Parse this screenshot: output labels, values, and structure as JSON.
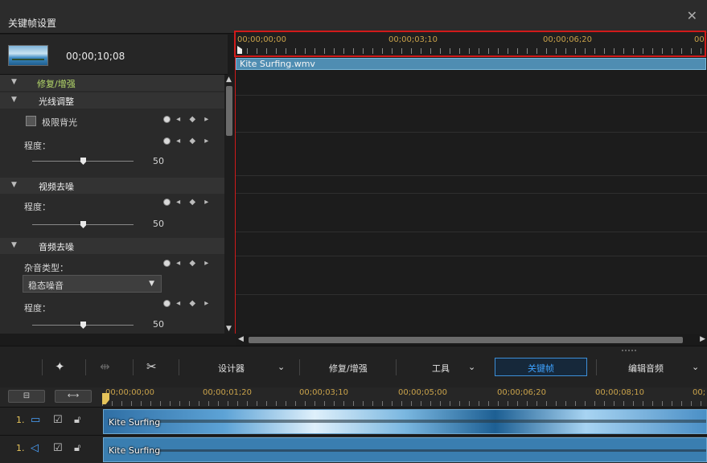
{
  "window": {
    "title": "关键帧设置",
    "close_glyph": "✕"
  },
  "preview": {
    "timecode": "00;00;10;08"
  },
  "panel": {
    "section_repair": "修复/增强",
    "backlight": {
      "title": "光线调整",
      "checkbox_label": "极限背光",
      "degree_label": "程度：",
      "value": "50",
      "slider_fraction": 0.5
    },
    "video_denoise": {
      "title": "视频去噪",
      "degree_label": "程度：",
      "value": "50",
      "slider_fraction": 0.5
    },
    "audio_denoise": {
      "title": "音频去噪",
      "noise_type_label": "杂音类型：",
      "noise_type_value": "稳态噪音",
      "degree_label": "程度：",
      "value": "50",
      "slider_fraction": 0.5
    }
  },
  "keyframe_ruler": {
    "ticks": [
      "00;00;00;00",
      "00;00;03;10",
      "00;00;06;20",
      "00"
    ]
  },
  "clip": {
    "name": "Kite Surfing.wmv"
  },
  "toolbar": {
    "designer": "设计器",
    "repair": "修复/增强",
    "tools": "工具",
    "keyframe": "关键帧",
    "edit_audio": "编辑音频"
  },
  "timeline": {
    "ticks": [
      "00;00;00;00",
      "00;00;01;20",
      "00;00;03;10",
      "00;00;05;00",
      "00;00;06;20",
      "00;00;08;10",
      "00;"
    ],
    "tracks": [
      {
        "num": "1.",
        "clip_label": "Kite Surfing"
      },
      {
        "num": "1.",
        "clip_label": "Kite Surfing"
      }
    ]
  }
}
